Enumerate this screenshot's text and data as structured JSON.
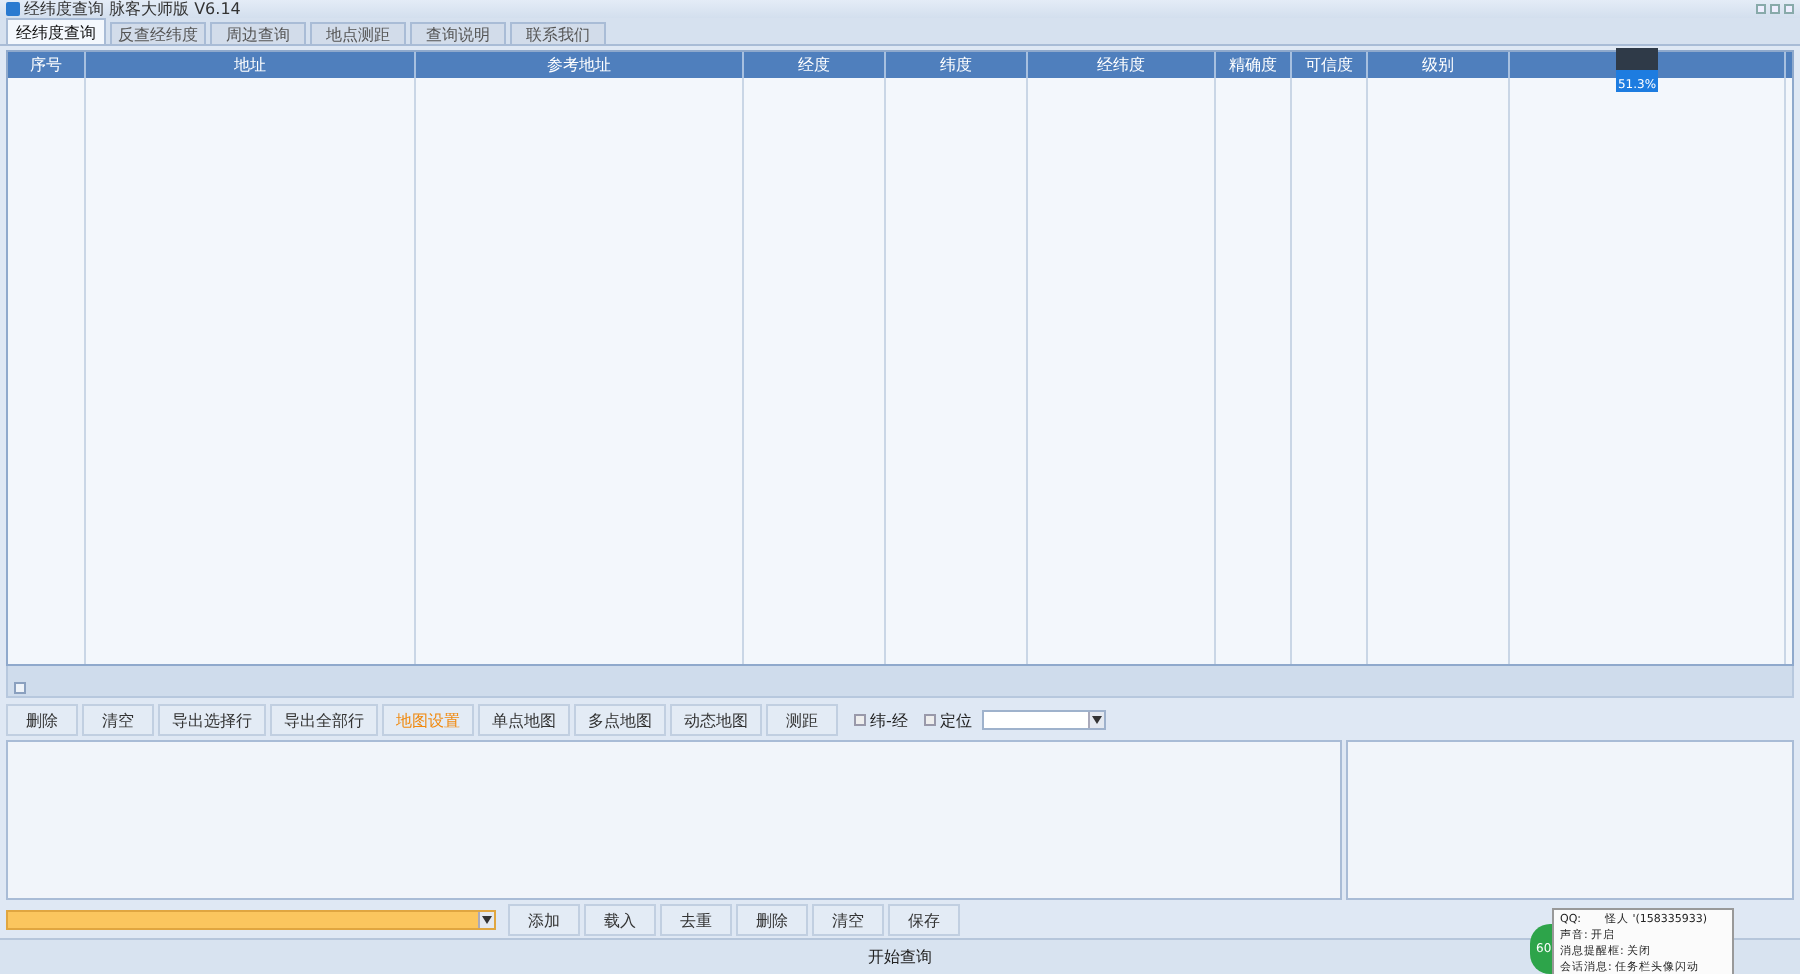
{
  "window": {
    "title": "经纬度查询 脉客大师版 V6.14"
  },
  "tabs": [
    {
      "label": "经纬度查询",
      "selected": true
    },
    {
      "label": "反查经纬度",
      "selected": false
    },
    {
      "label": "周边查询",
      "selected": false
    },
    {
      "label": "地点测距",
      "selected": false
    },
    {
      "label": "查询说明",
      "selected": false
    },
    {
      "label": "联系我们",
      "selected": false
    }
  ],
  "table": {
    "columns": [
      "序号",
      "地址",
      "参考地址",
      "经度",
      "纬度",
      "经纬度",
      "精确度",
      "可信度",
      "级别",
      ""
    ]
  },
  "toolbar": {
    "buttons": [
      {
        "label": "删除",
        "selected": false
      },
      {
        "label": "清空",
        "selected": false
      },
      {
        "label": "导出选择行",
        "selected": false
      },
      {
        "label": "导出全部行",
        "selected": false
      },
      {
        "label": "地图设置",
        "selected": true
      },
      {
        "label": "单点地图",
        "selected": false
      },
      {
        "label": "多点地图",
        "selected": false
      },
      {
        "label": "动态地图",
        "selected": false
      },
      {
        "label": "测距",
        "selected": false
      }
    ],
    "checkboxes": [
      {
        "label": "纬-经",
        "checked": false
      },
      {
        "label": "定位",
        "checked": false
      }
    ]
  },
  "input_row": {
    "buttons": [
      "添加",
      "载入",
      "去重",
      "删除",
      "清空",
      "保存"
    ]
  },
  "status_bar": {
    "text": "开始查询"
  },
  "speed_widget": {
    "reading": "51.3%"
  },
  "tray_badge": {
    "text": "60"
  },
  "qq_tooltip": {
    "lines": [
      {
        "label": "QQ:",
        "value": "怪人 '(158335933)"
      },
      {
        "label": "声音: 开启"
      },
      {
        "label": "消息提醒框: 关闭"
      },
      {
        "label": "会话消息: 任务栏头像闪动"
      }
    ]
  }
}
